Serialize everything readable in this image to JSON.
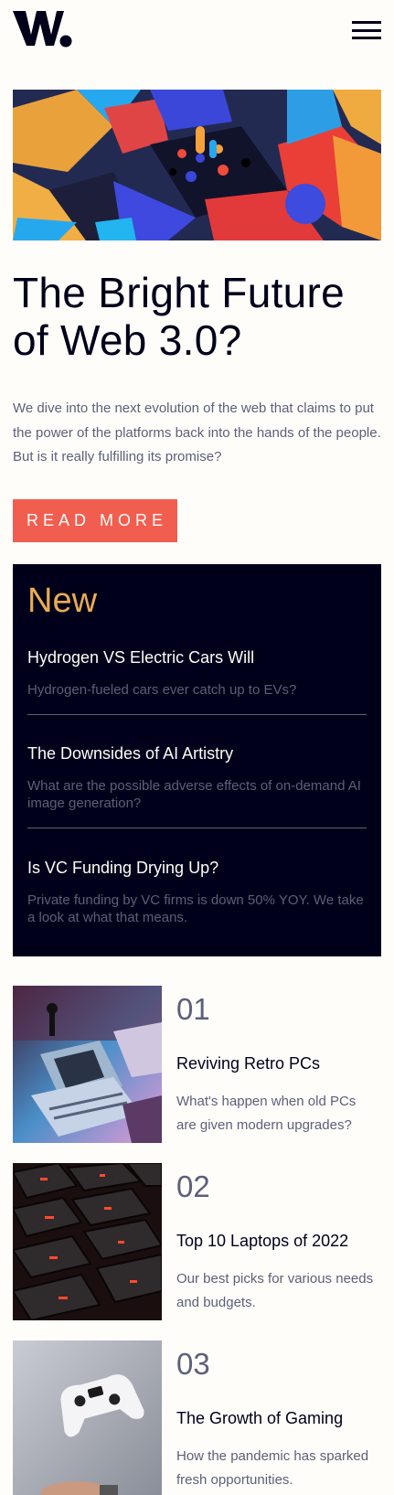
{
  "header": {
    "logo_alt": "W.",
    "menu_icon": "hamburger-menu-icon"
  },
  "hero": {
    "title": "The Bright Future of Web 3.0?",
    "description": "We dive into the next evolution of the web that claims to put the power of the platforms back into the hands of the people. But is it really fulfilling its promise?",
    "button_label": "Read more"
  },
  "new_section": {
    "heading": "New",
    "items": [
      {
        "title": "Hydrogen VS Electric Cars Will",
        "description": "Hydrogen-fueled cars ever catch up to EVs?"
      },
      {
        "title": "The Downsides of AI Artistry",
        "description": "What are the possible adverse effects of on-demand AI image generation?"
      },
      {
        "title": "Is VC Funding Drying Up?",
        "description": "Private funding by VC firms is down 50% YOY. We take a look at what that means."
      }
    ]
  },
  "articles": [
    {
      "number": "01",
      "title": "Reviving Retro PCs",
      "description": "What's happen when old PCs are given modern upgrades?"
    },
    {
      "number": "02",
      "title": "Top 10 Laptops of 2022",
      "description": "Our best picks for various needs and budgets."
    },
    {
      "number": "03",
      "title": "The Growth of Gaming",
      "description": "How the pandemic has sparked fresh opportunities."
    }
  ],
  "colors": {
    "background": "#fffdfa",
    "dark": "#00001a",
    "accent_red": "#f15e50",
    "accent_orange": "#e9ab53",
    "muted": "#5d5f79"
  }
}
